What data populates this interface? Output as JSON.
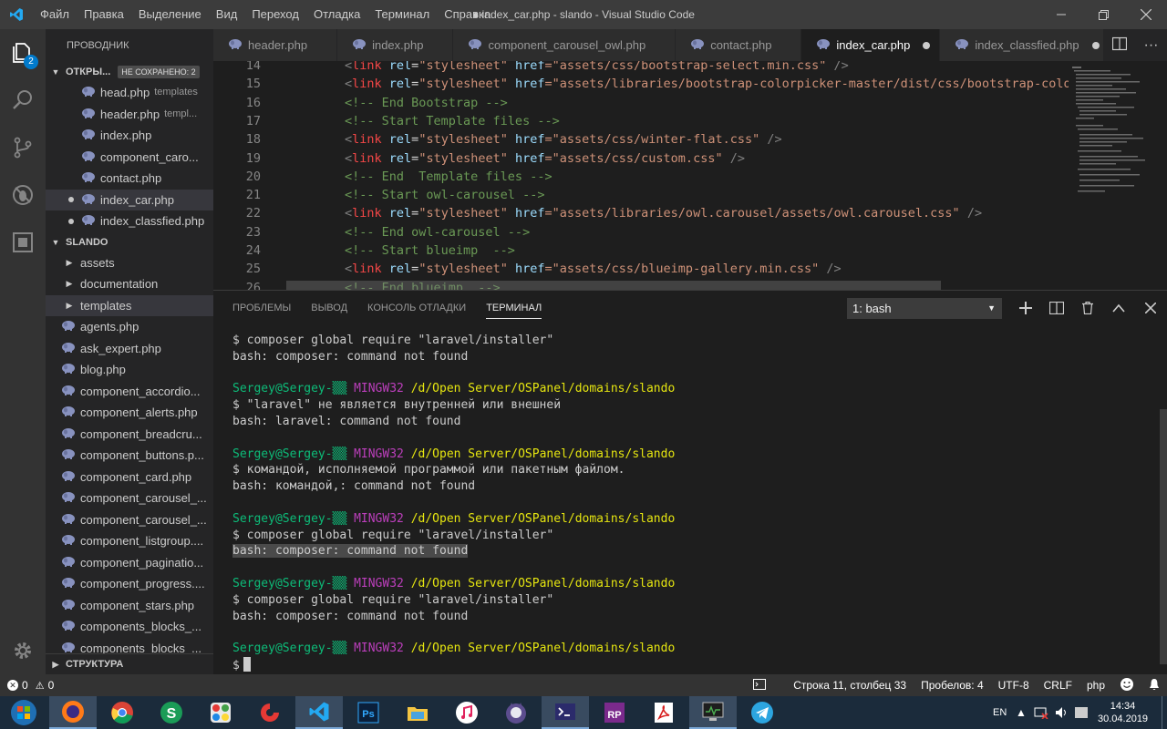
{
  "titlebar": {
    "menu": [
      "Файл",
      "Правка",
      "Выделение",
      "Вид",
      "Переход",
      "Отладка",
      "Терминал",
      "Справка"
    ],
    "title": "● index_car.php - slando - Visual Studio Code"
  },
  "activity": {
    "badge": "2"
  },
  "sidebar": {
    "title": "ПРОВОДНИК",
    "open_editors": {
      "label": "ОТКРЫ...",
      "unsaved": "НЕ СОХРАНЕНО: 2",
      "items": [
        {
          "name": "head.php",
          "desc": "templates",
          "modified": false
        },
        {
          "name": "header.php",
          "desc": "templ...",
          "modified": false
        },
        {
          "name": "index.php",
          "desc": "",
          "modified": false
        },
        {
          "name": "component_caro...",
          "desc": "",
          "modified": false
        },
        {
          "name": "contact.php",
          "desc": "",
          "modified": false
        },
        {
          "name": "index_car.php",
          "desc": "",
          "modified": true
        },
        {
          "name": "index_classfied.php",
          "desc": "",
          "modified": true
        }
      ]
    },
    "project": {
      "label": "SLANDO",
      "folders": [
        "assets",
        "documentation",
        "templates"
      ],
      "files": [
        "agents.php",
        "ask_expert.php",
        "blog.php",
        "component_accordio...",
        "component_alerts.php",
        "component_breadcru...",
        "component_buttons.p...",
        "component_card.php",
        "component_carousel_...",
        "component_carousel_...",
        "component_listgroup....",
        "component_paginatio...",
        "component_progress....",
        "component_stars.php",
        "components_blocks_...",
        "components_blocks_..."
      ]
    },
    "outline": "СТРУКТУРА"
  },
  "tabs": [
    {
      "label": "header.php",
      "active": false,
      "modified": false
    },
    {
      "label": "index.php",
      "active": false,
      "modified": false
    },
    {
      "label": "component_carousel_owl.php",
      "active": false,
      "modified": false
    },
    {
      "label": "contact.php",
      "active": false,
      "modified": false
    },
    {
      "label": "index_car.php",
      "active": true,
      "modified": true
    },
    {
      "label": "index_classfied.php",
      "active": false,
      "modified": true
    }
  ],
  "editor": {
    "lines": [
      {
        "n": "14",
        "kind": "link",
        "href": "assets/css/bootstrap-select.min.css",
        "end": " />"
      },
      {
        "n": "15",
        "kind": "link",
        "href": "assets/libraries/bootstrap-colorpicker-master/dist/css/bootstrap-colorp",
        "end": ""
      },
      {
        "n": "16",
        "kind": "comment",
        "text": "<!-- End Bootstrap -->"
      },
      {
        "n": "17",
        "kind": "comment",
        "text": "<!-- Start Template files -->"
      },
      {
        "n": "18",
        "kind": "link",
        "href": "assets/css/winter-flat.css",
        "end": " />"
      },
      {
        "n": "19",
        "kind": "link",
        "href": "assets/css/custom.css",
        "end": " />"
      },
      {
        "n": "20",
        "kind": "comment",
        "text": "<!-- End  Template files -->"
      },
      {
        "n": "21",
        "kind": "comment",
        "text": "<!-- Start owl-carousel -->"
      },
      {
        "n": "22",
        "kind": "link",
        "href": "assets/libraries/owl.carousel/assets/owl.carousel.css",
        "end": " />"
      },
      {
        "n": "23",
        "kind": "comment",
        "text": "<!-- End owl-carousel -->"
      },
      {
        "n": "24",
        "kind": "comment",
        "text": "<!-- Start blueimp  -->"
      },
      {
        "n": "25",
        "kind": "link",
        "href": "assets/css/blueimp-gallery.min.css",
        "end": " />"
      },
      {
        "n": "26",
        "kind": "comment",
        "text": "<!-- End blueimp  -->"
      }
    ]
  },
  "panel": {
    "tabs": [
      "ПРОБЛЕМЫ",
      "ВЫВОД",
      "КОНСОЛЬ ОТЛАДКИ",
      "ТЕРМИНАЛ"
    ],
    "active_tab": "ТЕРМИНАЛ",
    "terminal_select": "1: bash",
    "terminal": [
      {
        "t": "cmd",
        "text": "$ composer global require \"laravel/installer\""
      },
      {
        "t": "out",
        "text": "bash: composer: command not found"
      },
      {
        "t": "blank"
      },
      {
        "t": "prompt",
        "user": "Sergey@Sergey-▒▒",
        "sys": "MINGW32",
        "path": "/d/Open Server/OSPanel/domains/slando"
      },
      {
        "t": "cmd",
        "text": "$ \"laravel\" не является внутренней или внешней"
      },
      {
        "t": "out",
        "text": "bash: laravel: command not found"
      },
      {
        "t": "blank"
      },
      {
        "t": "prompt",
        "user": "Sergey@Sergey-▒▒",
        "sys": "MINGW32",
        "path": "/d/Open Server/OSPanel/domains/slando"
      },
      {
        "t": "cmd",
        "text": "$ командой, исполняемой программой или пакетным файлом."
      },
      {
        "t": "out",
        "text": "bash: командой,: command not found"
      },
      {
        "t": "blank"
      },
      {
        "t": "prompt",
        "user": "Sergey@Sergey-▒▒",
        "sys": "MINGW32",
        "path": "/d/Open Server/OSPanel/domains/slando"
      },
      {
        "t": "cmd",
        "text": "$ composer global require \"laravel/installer\""
      },
      {
        "t": "out",
        "text": "bash: composer: command not found",
        "highlight": true
      },
      {
        "t": "blank"
      },
      {
        "t": "prompt",
        "user": "Sergey@Sergey-▒▒",
        "sys": "MINGW32",
        "path": "/d/Open Server/OSPanel/domains/slando"
      },
      {
        "t": "cmd",
        "text": "$ composer global require \"laravel/installer\""
      },
      {
        "t": "out",
        "text": "bash: composer: command not found"
      },
      {
        "t": "blank"
      },
      {
        "t": "prompt",
        "user": "Sergey@Sergey-▒▒",
        "sys": "MINGW32",
        "path": "/d/Open Server/OSPanel/domains/slando"
      },
      {
        "t": "input",
        "text": "$"
      }
    ]
  },
  "status": {
    "errors": "0",
    "warnings": "0",
    "position": "Строка 11, столбец 33",
    "spaces": "Пробелов: 4",
    "encoding": "UTF-8",
    "eol": "CRLF",
    "language": "php"
  },
  "taskbar": {
    "lang": "EN",
    "time": "14:34",
    "date": "30.04.2019",
    "apps": [
      "start",
      "firefox",
      "chrome",
      "skype",
      "paint",
      "ccleaner",
      "vscode",
      "photoshop",
      "explorer",
      "itunes",
      "gitkraken",
      "terminal",
      "rp",
      "acrobat",
      "task-manager",
      "telegram"
    ]
  },
  "colors": {
    "accent": "#007acc",
    "prompt_user": "#0dbc79",
    "prompt_sys": "#bc3fbc",
    "prompt_path": "#e5e510"
  }
}
